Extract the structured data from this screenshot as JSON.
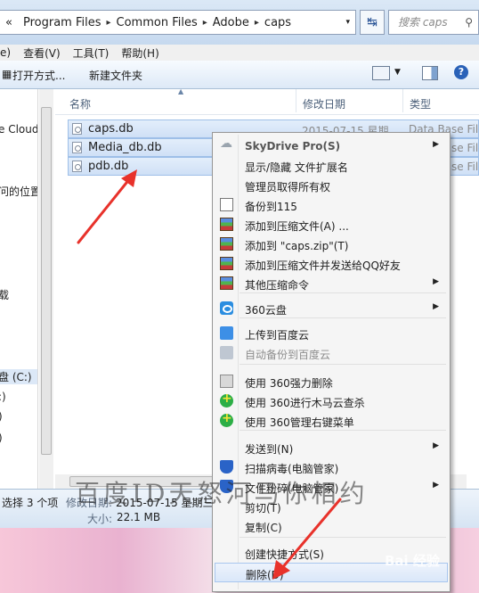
{
  "address": {
    "back_glyph": "«",
    "crumbs": [
      "Program Files",
      "Common Files",
      "Adobe",
      "caps"
    ],
    "sep": "▸",
    "dropdown": "▾",
    "refresh_glyph": "↹"
  },
  "search": {
    "placeholder": "搜索 caps",
    "icon": "search-icon"
  },
  "menubar": [
    "e)",
    "查看(V)",
    "工具(T)",
    "帮助(H)"
  ],
  "toolbar": {
    "open_with": "打开方式...",
    "new_folder": "新建文件夹"
  },
  "nav": {
    "items": [
      "e Cloud",
      "问的位置",
      "载",
      "盘 (C:)",
      ":)",
      ")",
      ")"
    ]
  },
  "columns": {
    "name": "名称",
    "modified": "修改日期",
    "type": "类型"
  },
  "files": [
    {
      "name": "caps.db",
      "date": "2015-07-15 星期...",
      "type": "Data Base File"
    },
    {
      "name": "Media_db.db",
      "date": "",
      "type": "Data Base File"
    },
    {
      "name": "pdb.db",
      "date": "",
      "type": "Data Base File"
    }
  ],
  "status": {
    "selected": "选择 3 个项",
    "modified_label": "修改日期:",
    "modified_value": "2015-07-15 星期三",
    "size_label": "大小:",
    "size_value": "22.1 MB"
  },
  "context_menu": {
    "items": [
      {
        "label": "SkyDrive Pro(S)",
        "icon": "skydrive-icon",
        "submenu": true
      },
      {
        "label": "显示/隐藏 文件扩展名",
        "icon": "",
        "submenu": false
      },
      {
        "label": "管理员取得所有权",
        "icon": "",
        "submenu": false
      },
      {
        "label": "备份到115",
        "icon": "backup-115-icon",
        "submenu": false
      },
      {
        "label": "添加到压缩文件(A) ...",
        "icon": "winrar-icon",
        "submenu": false
      },
      {
        "label": "添加到 \"caps.zip\"(T)",
        "icon": "winrar-icon",
        "submenu": false
      },
      {
        "label": "添加到压缩文件并发送给QQ好友",
        "icon": "winrar-icon",
        "submenu": false
      },
      {
        "label": "其他压缩命令",
        "icon": "winrar-icon",
        "submenu": true
      },
      {
        "label": "360云盘",
        "icon": "360-cloud-icon",
        "submenu": true
      },
      {
        "label": "上传到百度云",
        "icon": "baidu-cloud-icon",
        "submenu": false
      },
      {
        "label": "自动备份到百度云",
        "icon": "baidu-cloud-gray-icon",
        "submenu": false
      },
      {
        "label": "使用 360强力删除",
        "icon": "shredder-icon",
        "submenu": false
      },
      {
        "label": "使用 360进行木马云查杀",
        "icon": "360-plus-icon",
        "submenu": false
      },
      {
        "label": "使用 360管理右键菜单",
        "icon": "360-plus-icon",
        "submenu": false
      },
      {
        "label": "发送到(N)",
        "icon": "",
        "submenu": true
      },
      {
        "label": "扫描病毒(电脑管家)",
        "icon": "pcmgr-shield-icon",
        "submenu": false
      },
      {
        "label": "文件粉碎(电脑管家)",
        "icon": "pcmgr-shield-icon",
        "submenu": true
      },
      {
        "label": "剪切(T)",
        "icon": "",
        "submenu": false
      },
      {
        "label": "复制(C)",
        "icon": "",
        "submenu": false
      },
      {
        "label": "创建快捷方式(S)",
        "icon": "",
        "submenu": false
      },
      {
        "label": "删除(D)",
        "icon": "",
        "submenu": false
      }
    ],
    "submenu_arrow": "▶"
  },
  "watermark": "百度ID天怒河马你相约",
  "brand_mark": "Bai 经验"
}
